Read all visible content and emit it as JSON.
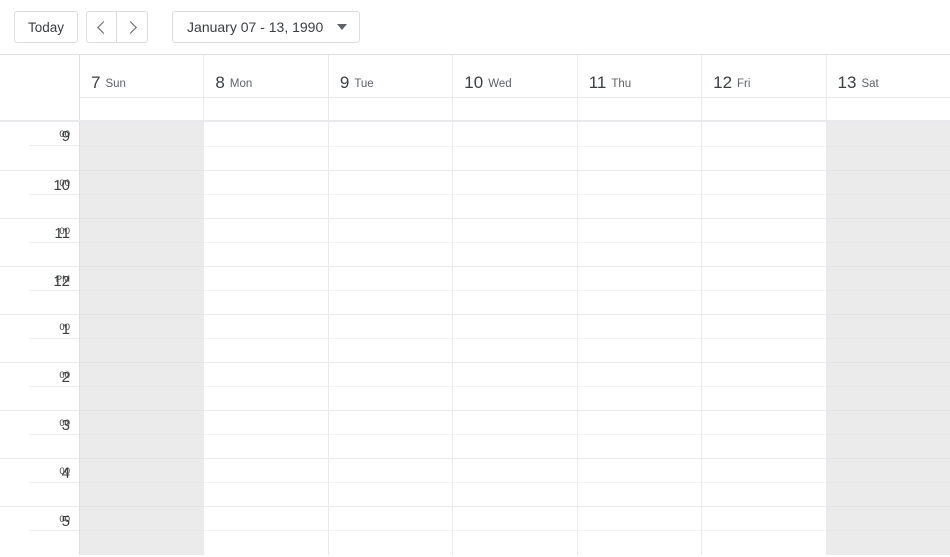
{
  "toolbar": {
    "today_label": "Today",
    "prev_icon": "chevron-left-icon",
    "next_icon": "chevron-right-icon",
    "date_range_label": "January 07 - 13, 1990",
    "dropdown_icon": "chevron-down-icon"
  },
  "calendar": {
    "view": "week",
    "days": [
      {
        "num": "7",
        "name": "Sun",
        "weekend": true
      },
      {
        "num": "8",
        "name": "Mon",
        "weekend": false
      },
      {
        "num": "9",
        "name": "Tue",
        "weekend": false
      },
      {
        "num": "10",
        "name": "Wed",
        "weekend": false
      },
      {
        "num": "11",
        "name": "Thu",
        "weekend": false
      },
      {
        "num": "12",
        "name": "Fri",
        "weekend": false
      },
      {
        "num": "13",
        "name": "Sat",
        "weekend": true
      }
    ],
    "hours": [
      {
        "hour": "9",
        "mins": "00"
      },
      {
        "hour": "10",
        "mins": "00"
      },
      {
        "hour": "11",
        "mins": "00"
      },
      {
        "hour": "12",
        "mins": "PM"
      },
      {
        "hour": "1",
        "mins": "00"
      },
      {
        "hour": "2",
        "mins": "00"
      },
      {
        "hour": "3",
        "mins": "00"
      },
      {
        "hour": "4",
        "mins": "00"
      },
      {
        "hour": "5",
        "mins": "00"
      }
    ],
    "events": [],
    "allday_events": []
  },
  "colors": {
    "text": "#3c4043",
    "muted": "#5f6368",
    "border": "#e0e0e0",
    "grid_line": "#e8eaed",
    "half_hour_line": "#f1f3f4",
    "weekend_bg": "#ebebeb",
    "page_bg": "#ffffff"
  }
}
